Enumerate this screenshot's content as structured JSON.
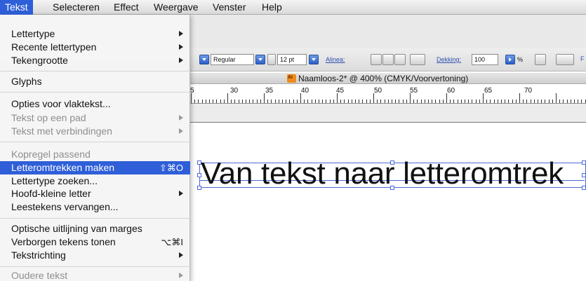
{
  "menubar": {
    "items": [
      {
        "label": "Tekst",
        "active": true
      },
      {
        "label": "Selecteren"
      },
      {
        "label": "Effect"
      },
      {
        "label": "Weergave"
      },
      {
        "label": "Venster"
      },
      {
        "label": "Help"
      }
    ]
  },
  "menu": {
    "items": [
      {
        "label": "Lettertype",
        "submenu": true
      },
      {
        "label": "Recente lettertypen",
        "submenu": true
      },
      {
        "label": "Tekengrootte",
        "submenu": true
      },
      {
        "label": "Glyphs"
      },
      {
        "label": "Opties voor vlaktekst..."
      },
      {
        "label": "Tekst op een pad",
        "submenu": true,
        "disabled": true
      },
      {
        "label": "Tekst met verbindingen",
        "submenu": true,
        "disabled": true
      },
      {
        "label": "Kopregel passend",
        "disabled": true
      },
      {
        "label": "Letteromtrekken maken",
        "shortcut": "⇧⌘O",
        "highlighted": true
      },
      {
        "label": "Lettertype zoeken..."
      },
      {
        "label": "Hoofd-kleine letter",
        "submenu": true
      },
      {
        "label": "Leestekens vervangen..."
      },
      {
        "label": "Optische uitlijning van marges"
      },
      {
        "label": "Verborgen tekens tonen",
        "shortcut": "⌥⌘I"
      },
      {
        "label": "Tekstrichting",
        "submenu": true
      },
      {
        "label": "Oudere tekst",
        "submenu": true,
        "disabled": true
      }
    ]
  },
  "control_bar": {
    "font_style": "Regular",
    "font_size": "12 pt",
    "alinea_label": "Alinea:",
    "dekking_label": "Dekking:",
    "dekking_value": "100",
    "percent": "%",
    "truncated_letter": "F"
  },
  "document": {
    "title": "Naamloos-2* @ 400% (CMYK/Voorvertoning)",
    "ruler_labels": [
      "5",
      "30",
      "35",
      "40",
      "45",
      "50",
      "55",
      "60",
      "65",
      "70"
    ]
  },
  "canvas": {
    "text": "Van tekst naar letteromtrek"
  },
  "colors": {
    "highlight": "#2f5fd8",
    "selection": "#4b69d8"
  }
}
